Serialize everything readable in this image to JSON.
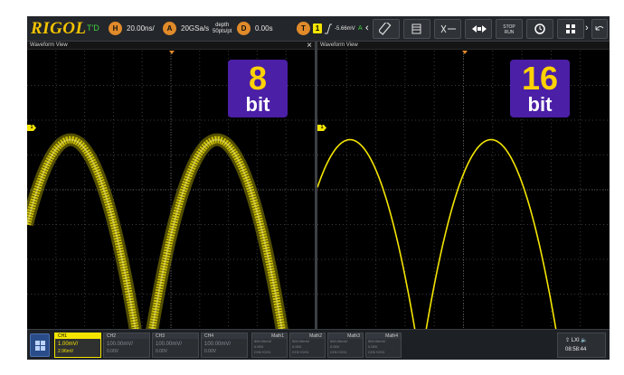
{
  "toolbar": {
    "brand": "RIGOL",
    "run_state": "T'D",
    "horizontal_badge": "H",
    "timebase": "20.00ns/",
    "acquire_badge": "A",
    "sample_rate": "20GSa/s",
    "depth_label": "depth",
    "depth_value": "50pts/pt",
    "delay_badge": "D",
    "delay": "0.00s",
    "trigger_badge": "T",
    "trigger_source": "1",
    "trigger_level": "-5.66mV",
    "trigger_coupling": "A",
    "stop_label": "STOP",
    "run_label": "RUN"
  },
  "panels": {
    "left": {
      "title": "Waveform View",
      "bit_number": "8",
      "bit_unit": "bit"
    },
    "right": {
      "title": "Waveform View",
      "bit_number": "16",
      "bit_unit": "bit"
    },
    "channel_marker": "1"
  },
  "channels": [
    {
      "name": "CH1",
      "scale": "1.00mV/",
      "offset": "2.96mV",
      "active": true
    },
    {
      "name": "CH2",
      "scale": "100.00mV/",
      "offset": "0.00V",
      "active": false
    },
    {
      "name": "CH3",
      "scale": "100.00mV/",
      "offset": "0.00V",
      "active": false
    },
    {
      "name": "CH4",
      "scale": "100.00mV/",
      "offset": "0.00V",
      "active": false
    }
  ],
  "math": [
    {
      "name": "Math1",
      "scale": "500.00mV/",
      "offset": "0.00V",
      "expr": "CH1+CH1"
    },
    {
      "name": "Math2",
      "scale": "500.00mV/",
      "offset": "0.00V",
      "expr": "CH1+CH1"
    },
    {
      "name": "Math3",
      "scale": "500.00mV/",
      "offset": "0.00V",
      "expr": "CH1+CH1"
    },
    {
      "name": "Math4",
      "scale": "500.00mV/",
      "offset": "0.00V",
      "expr": "CH1+CH1"
    }
  ],
  "status": {
    "indicator": "LXI",
    "time": "08:58:44"
  },
  "colors": {
    "ch1": "#f4e500",
    "accent": "#e08a2a",
    "badge_bg": "#4b1fa6",
    "badge_text": "#ffd200"
  },
  "icons": [
    "horizontal-badge-icon",
    "trigger-edge-icon",
    "measure-icon",
    "grid-icon",
    "cursor-icon",
    "zoom-icon",
    "history-icon",
    "layout-icon",
    "back-icon"
  ]
}
